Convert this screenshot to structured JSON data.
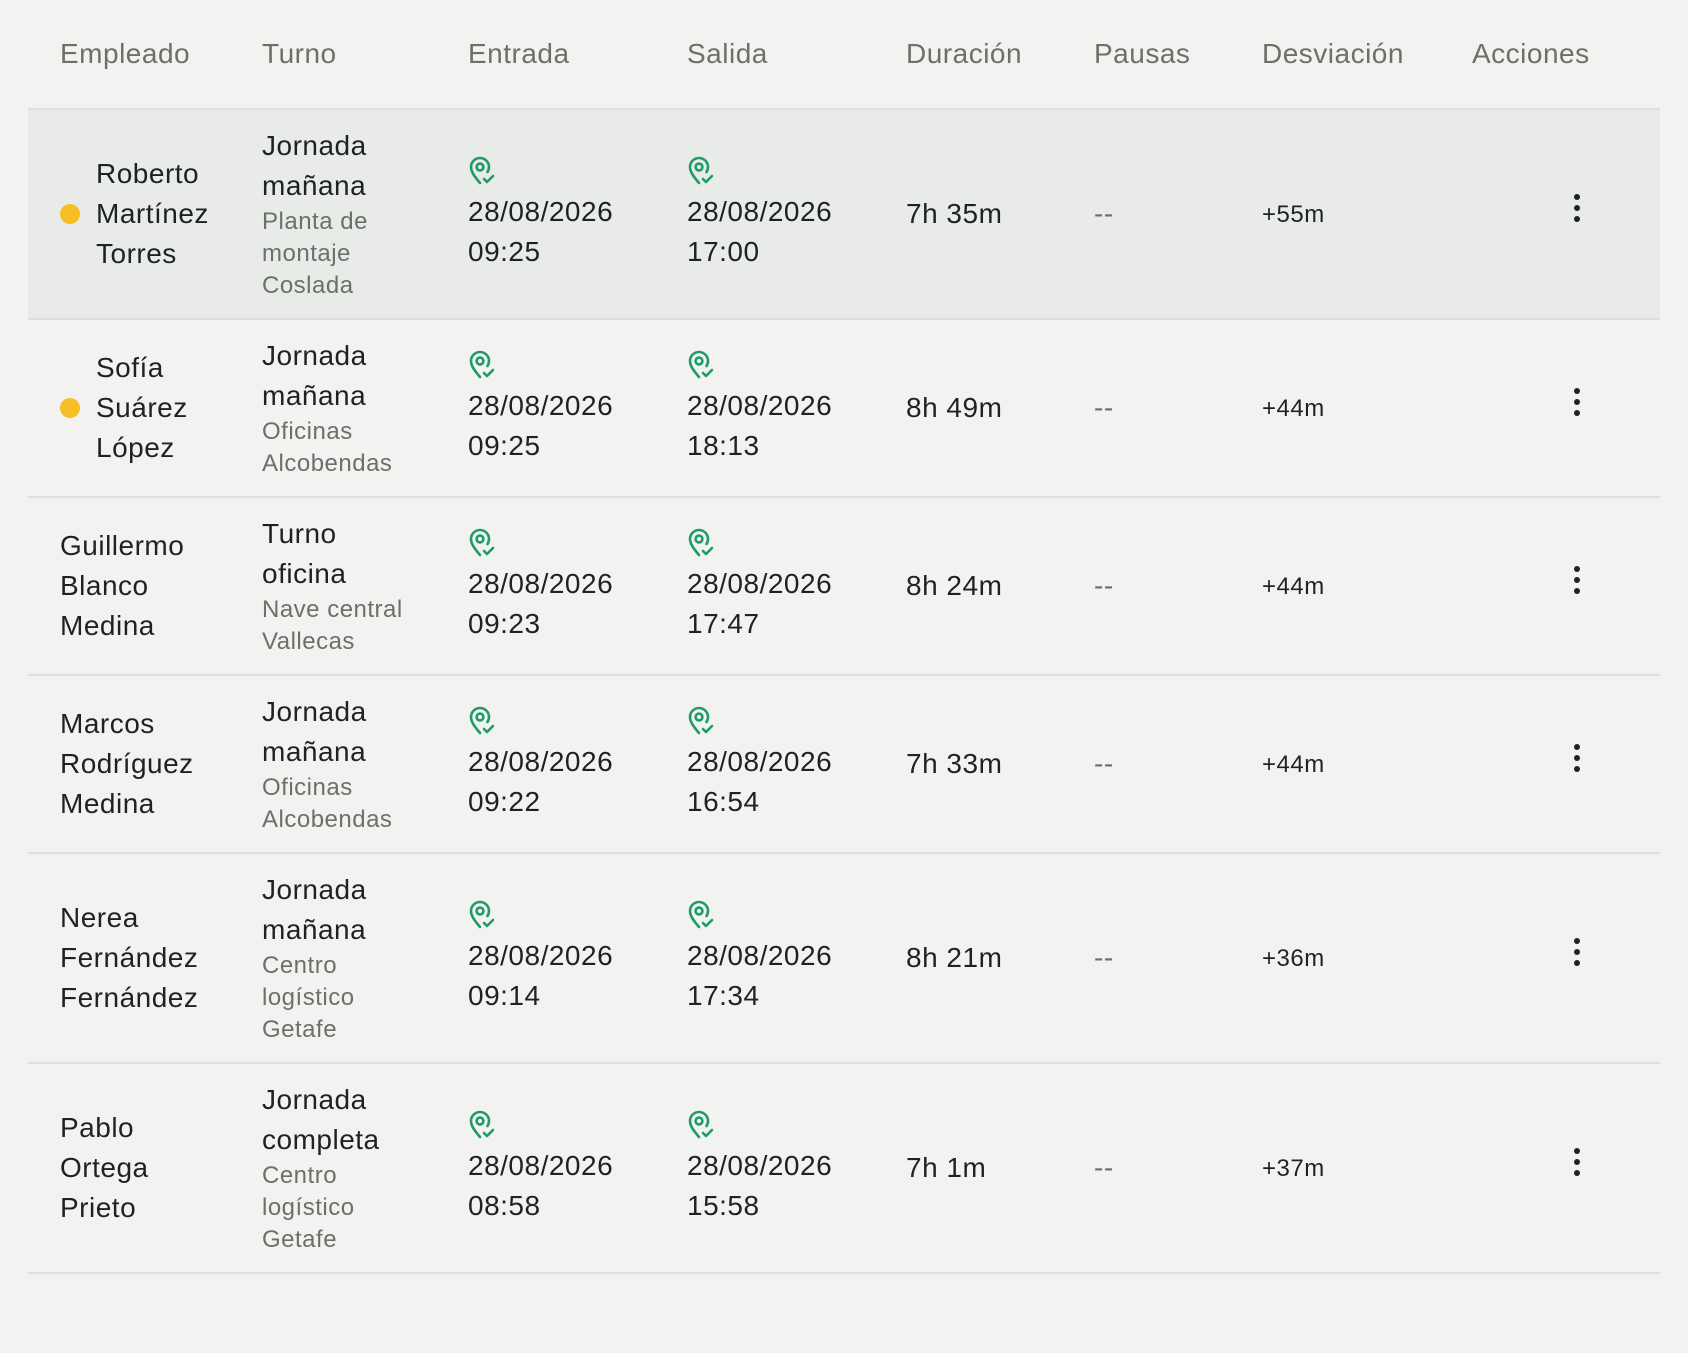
{
  "columns": {
    "employee": "Empleado",
    "shift": "Turno",
    "entry": "Entrada",
    "exit": "Salida",
    "duration": "Duración",
    "breaks": "Pausas",
    "deviation": "Desviación",
    "actions": "Acciones"
  },
  "colors": {
    "status_dot": "#f7bf25",
    "pin_icon": "#1f9a6a",
    "row_highlight": "#e8ebe7"
  },
  "rows": [
    {
      "name_lines": [
        "Roberto",
        "Martínez",
        "Torres"
      ],
      "status_dot": true,
      "highlight": true,
      "shift_lines": [
        "Jornada",
        "mañana"
      ],
      "location_lines": [
        "Planta de",
        "montaje",
        "Coslada"
      ],
      "entry_date": "28/08/2026",
      "entry_time": "09:25",
      "exit_date": "28/08/2026",
      "exit_time": "17:00",
      "duration": "7h 35m",
      "breaks": "--",
      "deviation": "+55m",
      "entry_icon": "location-check-icon",
      "exit_icon": "location-check-icon",
      "action_icon": "more-vertical-icon"
    },
    {
      "name_lines": [
        "Sofía",
        "Suárez",
        "López"
      ],
      "status_dot": true,
      "highlight": false,
      "shift_lines": [
        "Jornada",
        "mañana"
      ],
      "location_lines": [
        "Oficinas",
        "Alcobendas"
      ],
      "entry_date": "28/08/2026",
      "entry_time": "09:25",
      "exit_date": "28/08/2026",
      "exit_time": "18:13",
      "duration": "8h 49m",
      "breaks": "--",
      "deviation": "+44m",
      "entry_icon": "location-check-icon",
      "exit_icon": "location-check-icon",
      "action_icon": "more-vertical-icon"
    },
    {
      "name_lines": [
        "Guillermo",
        "Blanco",
        "Medina"
      ],
      "status_dot": false,
      "highlight": false,
      "shift_lines": [
        "Turno",
        "oficina"
      ],
      "location_lines": [
        "Nave central",
        "Vallecas"
      ],
      "entry_date": "28/08/2026",
      "entry_time": "09:23",
      "exit_date": "28/08/2026",
      "exit_time": "17:47",
      "duration": "8h 24m",
      "breaks": "--",
      "deviation": "+44m",
      "entry_icon": "location-check-icon",
      "exit_icon": "location-check-icon",
      "action_icon": "more-vertical-icon"
    },
    {
      "name_lines": [
        "Marcos",
        "Rodríguez",
        "Medina"
      ],
      "status_dot": false,
      "highlight": false,
      "shift_lines": [
        "Jornada",
        "mañana"
      ],
      "location_lines": [
        "Oficinas",
        "Alcobendas"
      ],
      "entry_date": "28/08/2026",
      "entry_time": "09:22",
      "exit_date": "28/08/2026",
      "exit_time": "16:54",
      "duration": "7h 33m",
      "breaks": "--",
      "deviation": "+44m",
      "entry_icon": "location-check-icon",
      "exit_icon": "location-check-icon",
      "action_icon": "more-vertical-icon"
    },
    {
      "name_lines": [
        "Nerea",
        "Fernández",
        "Fernández"
      ],
      "status_dot": false,
      "highlight": false,
      "shift_lines": [
        "Jornada",
        "mañana"
      ],
      "location_lines": [
        "Centro",
        "logístico",
        "Getafe"
      ],
      "entry_date": "28/08/2026",
      "entry_time": "09:14",
      "exit_date": "28/08/2026",
      "exit_time": "17:34",
      "duration": "8h 21m",
      "breaks": "--",
      "deviation": "+36m",
      "entry_icon": "location-check-icon",
      "exit_icon": "location-check-icon",
      "action_icon": "more-vertical-icon"
    },
    {
      "name_lines": [
        "Pablo",
        "Ortega",
        "Prieto"
      ],
      "status_dot": false,
      "highlight": false,
      "shift_lines": [
        "Jornada",
        "completa"
      ],
      "location_lines": [
        "Centro",
        "logístico",
        "Getafe"
      ],
      "entry_date": "28/08/2026",
      "entry_time": "08:58",
      "exit_date": "28/08/2026",
      "exit_time": "15:58",
      "duration": "7h 1m",
      "breaks": "--",
      "deviation": "+37m",
      "entry_icon": "location-check-icon",
      "exit_icon": "location-check-icon",
      "action_icon": "more-vertical-icon"
    }
  ]
}
